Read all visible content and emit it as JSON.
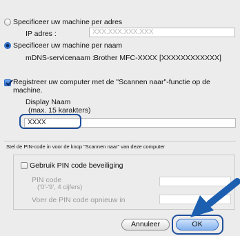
{
  "address_option": {
    "label": "Specificeer uw machine per adres",
    "ip_label": "IP adres :",
    "ip_placeholder": "XXX.XXX.XXX.XXX"
  },
  "name_option": {
    "label": "Specificeer uw machine per naam",
    "mdns_label": "mDNS-servicenaam :",
    "mdns_value": "Brother MFC-XXXX",
    "mdns_id": "[XXXXXXXXXXXX]"
  },
  "register": {
    "label_line1": "Registreer uw computer met de \"Scannen naar\"-functie op de",
    "label_line2": "machine.",
    "display_name_label": "Display Naam",
    "display_name_hint": "(max. 15 karakters)",
    "display_name_value": "XXXX"
  },
  "pin": {
    "section_title": "Stel de PIN-code in voor de knop \"Scannen naar\" van deze computer",
    "checkbox_label": "Gebruik PIN code beveiliging",
    "pin_label": "PIN code",
    "pin_hint": "('0'-'9', 4 cijfers)",
    "confirm_label": "Voer de PIN code opnieuw in"
  },
  "buttons": {
    "cancel": "Annuleer",
    "ok": "OK"
  },
  "colors": {
    "accent": "#1f4f9c",
    "arrow": "#1c5fb0"
  }
}
